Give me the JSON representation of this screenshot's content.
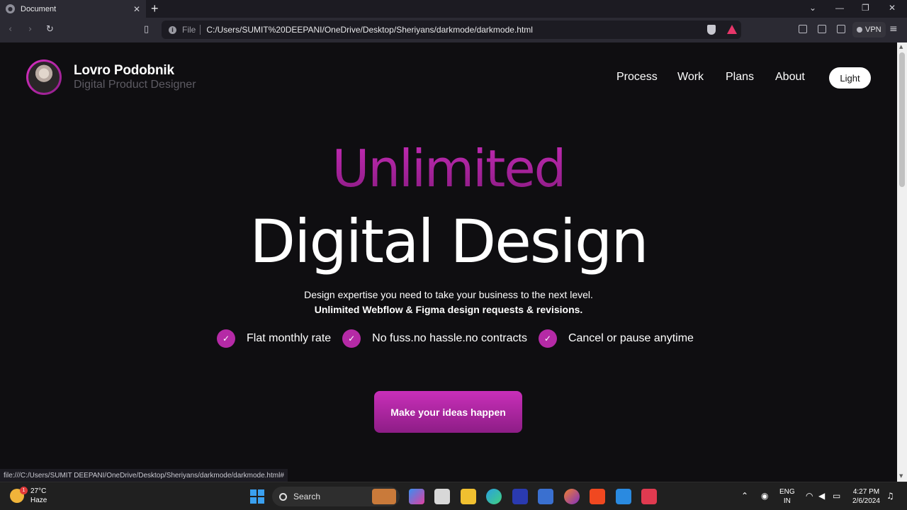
{
  "browser": {
    "tab_title": "Document",
    "tab_close": "✕",
    "new_tab": "+",
    "url_scheme": "File",
    "url": "C:/Users/SUMIT%20DEEPANI/OneDrive/Desktop/Sheriyans/darkmode/darkmode.html",
    "vpn_label": "VPN",
    "status_url": "file:///C:/Users/SUMIT DEEPANI/OneDrive/Desktop/Sheriyans/darkmode/darkmode.html#"
  },
  "header": {
    "name": "Lovro Podobnik",
    "role": "Digital Product Designer",
    "nav": [
      "Process",
      "Work",
      "Plans",
      "About"
    ],
    "theme_toggle": "Light"
  },
  "hero": {
    "title_top": "Unlimited",
    "title_main": "Digital Design",
    "subtitle": "Design expertise you need to take your business to the next level.",
    "subtitle_bold": "Unlimited Webflow & Figma design requests & revisions.",
    "features": [
      "Flat monthly rate",
      "No fuss.no hassle.no contracts",
      "Cancel or pause anytime"
    ],
    "cta": "Make your ideas happen"
  },
  "colors": {
    "accent": "#b52aa6",
    "background": "#0f0e11"
  },
  "taskbar": {
    "weather_badge": "1",
    "temperature": "27°C",
    "condition": "Haze",
    "search": "Search",
    "lang_top": "ENG",
    "lang_bottom": "IN",
    "time": "4:27 PM",
    "date": "2/6/2024"
  }
}
